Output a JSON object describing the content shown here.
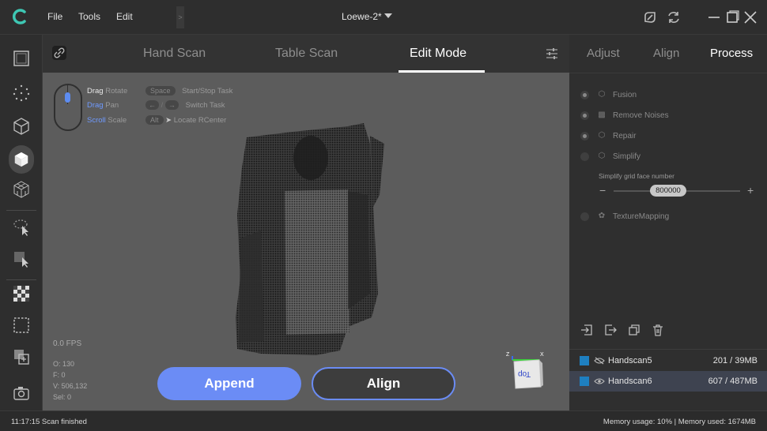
{
  "app": {
    "menu": [
      "File",
      "Tools",
      "Edit"
    ],
    "document_title": "Loewe-2*",
    "title_icons": [
      "refine-icon",
      "refresh-icon",
      "minimize-icon",
      "maximize-icon",
      "close-icon"
    ]
  },
  "left_toolbar": {
    "icons": [
      "frame-select-icon",
      "point-cloud-icon",
      "wireframe-cube-icon",
      "solid-cube-icon",
      "mesh-cube-icon",
      "lasso-select-icon",
      "brush-select-icon",
      "checker-icon",
      "dashed-select-icon",
      "layers-add-icon",
      "camera-icon"
    ],
    "active_index": 3
  },
  "mode_tabs": {
    "items": [
      "Hand Scan",
      "Table Scan",
      "Edit Mode"
    ],
    "active": "Edit Mode"
  },
  "hints": {
    "rotate_key": "Drag",
    "rotate_label": "Rotate",
    "pan_key": "Drag",
    "pan_label": "Pan",
    "scale_key": "Scroll",
    "scale_label": "Scale",
    "space_key": "Space",
    "space_label": "Start/Stop Task",
    "switch_label": "Switch Task",
    "alt_key": "Alt",
    "locate_label": "Locate RCenter"
  },
  "viewport_stats": {
    "fps": "0.0 FPS",
    "o": "O: 130",
    "f": "F: 0",
    "v": "V: 506,132",
    "sel": "Sel: 0"
  },
  "buttons": {
    "append": "Append",
    "align": "Align"
  },
  "gizmo": {
    "face_label": "Top",
    "axis_x": "X",
    "axis_z": "Z"
  },
  "right_panel": {
    "tabs": [
      "Adjust",
      "Align",
      "Process"
    ],
    "active_tab": "Process",
    "process_steps": [
      {
        "label": "Fusion",
        "checked": true
      },
      {
        "label": "Remove Noises",
        "checked": true
      },
      {
        "label": "Repair",
        "checked": true
      },
      {
        "label": "Simplify",
        "checked": false
      },
      {
        "label": "TextureMapping",
        "checked": false
      }
    ],
    "simplify_label": "Simplify grid face number",
    "simplify_value": "800000",
    "layer_tools": [
      "import-icon",
      "export-icon",
      "duplicate-icon",
      "delete-icon"
    ],
    "layers": [
      {
        "name": "Handscan5",
        "info": "201 / 39MB",
        "visible": false
      },
      {
        "name": "Handscan6",
        "info": "607 / 487MB",
        "visible": true
      }
    ]
  },
  "status": {
    "left": "11:17:15 Scan finished",
    "right": "Memory usage: 10% | Memory used: 1674MB"
  },
  "colors": {
    "accent": "#6b8cf5",
    "layer_checkbox": "#1e7fc0"
  }
}
